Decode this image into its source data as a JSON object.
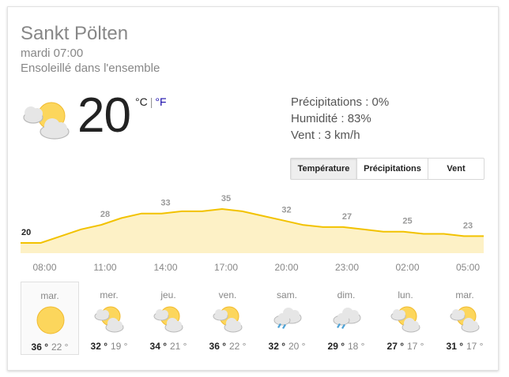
{
  "location": "Sankt Pölten",
  "datetime": "mardi 07:00",
  "condition": "Ensoleillé dans l'ensemble",
  "current": {
    "temp": "20",
    "unit_c": "°C",
    "separator": "|",
    "unit_f": "°F",
    "icon": "partly-sunny-icon"
  },
  "details": {
    "precip": "Précipitations : 0%",
    "humidity": "Humidité : 83%",
    "wind": "Vent : 3 km/h"
  },
  "tabs": [
    {
      "label": "Température",
      "active": true
    },
    {
      "label": "Précipitations",
      "active": false
    },
    {
      "label": "Vent",
      "active": false
    }
  ],
  "chart_data": {
    "type": "area",
    "title": "",
    "x": [
      "07:00",
      "08:00",
      "09:00",
      "10:00",
      "11:00",
      "12:00",
      "13:00",
      "14:00",
      "15:00",
      "16:00",
      "17:00",
      "18:00",
      "19:00",
      "20:00",
      "21:00",
      "22:00",
      "23:00",
      "00:00",
      "01:00",
      "02:00",
      "03:00",
      "04:00",
      "05:00",
      "06:00"
    ],
    "values": [
      20,
      20,
      23,
      26,
      28,
      31,
      33,
      33,
      34,
      34,
      35,
      34,
      32,
      30,
      28,
      27,
      27,
      26,
      25,
      25,
      24,
      24,
      23,
      23
    ],
    "point_labels": [
      {
        "hour": "07:00",
        "label": "20"
      },
      {
        "hour": "11:00",
        "label": "28"
      },
      {
        "hour": "14:00",
        "label": "33"
      },
      {
        "hour": "17:00",
        "label": "35"
      },
      {
        "hour": "20:00",
        "label": "32"
      },
      {
        "hour": "23:00",
        "label": "27"
      },
      {
        "hour": "02:00",
        "label": "25"
      },
      {
        "hour": "05:00",
        "label": "23"
      }
    ],
    "tick_labels": [
      "08:00",
      "11:00",
      "14:00",
      "17:00",
      "20:00",
      "23:00",
      "02:00",
      "05:00"
    ],
    "line_color": "#f2c200",
    "fill_color": "#fdf1c6"
  },
  "forecast": [
    {
      "day": "mar.",
      "icon": "sun-icon",
      "hi": "36 °",
      "lo": "22 °",
      "selected": true
    },
    {
      "day": "mer.",
      "icon": "partly-sunny-icon",
      "hi": "32 °",
      "lo": "19 °",
      "selected": false
    },
    {
      "day": "jeu.",
      "icon": "partly-sunny-icon",
      "hi": "34 °",
      "lo": "21 °",
      "selected": false
    },
    {
      "day": "ven.",
      "icon": "partly-sunny-icon",
      "hi": "36 °",
      "lo": "22 °",
      "selected": false
    },
    {
      "day": "sam.",
      "icon": "rain-cloud-icon",
      "hi": "32 °",
      "lo": "20 °",
      "selected": false
    },
    {
      "day": "dim.",
      "icon": "rain-cloud-icon",
      "hi": "29 °",
      "lo": "18 °",
      "selected": false
    },
    {
      "day": "lun.",
      "icon": "partly-sunny-icon",
      "hi": "27 °",
      "lo": "17 °",
      "selected": false
    },
    {
      "day": "mar.",
      "icon": "partly-sunny-icon",
      "hi": "31 °",
      "lo": "17 °",
      "selected": false
    }
  ],
  "colors": {
    "sun": "#fcd65c",
    "sun_edge": "#f1bb30",
    "cloud": "#e6e6e6",
    "cloud_edge": "#b9b9b9",
    "rain": "#4fa3d6",
    "link": "#1a0dab"
  }
}
